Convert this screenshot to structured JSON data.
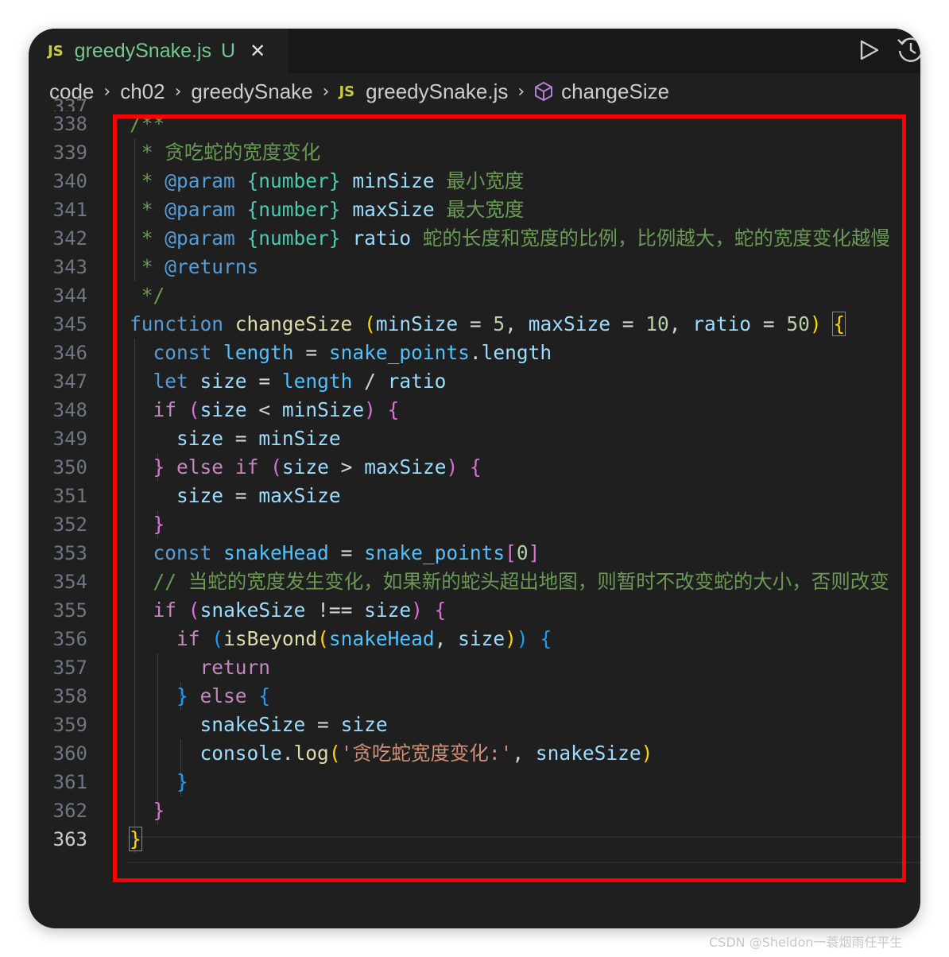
{
  "tab": {
    "icon": "JS",
    "filename": "greedySnake.js",
    "status": "U"
  },
  "breadcrumb": {
    "items": [
      "code",
      "ch02",
      "greedySnake",
      "greedySnake.js",
      "changeSize"
    ],
    "file_icon": "JS"
  },
  "code": {
    "partial_line_number": "337",
    "line_numbers": [
      "338",
      "339",
      "340",
      "341",
      "342",
      "343",
      "344",
      "345",
      "346",
      "347",
      "348",
      "349",
      "350",
      "351",
      "352",
      "353",
      "354",
      "355",
      "356",
      "357",
      "358",
      "359",
      "360",
      "361",
      "362",
      "363"
    ],
    "active_line": "363",
    "doc": {
      "open": "/**",
      "summary": " * 贪吃蛇的宽度变化",
      "star": " * ",
      "param_tag": "@param",
      "type_number": "{number}",
      "p1_name": "minSize",
      "p1_desc": "最小宽度",
      "p2_name": "maxSize",
      "p2_desc": "最大宽度",
      "p3_name": "ratio",
      "p3_desc": "蛇的长度和宽度的比例，比例越大，蛇的宽度变化越慢",
      "returns_tag": "@returns",
      "close": " */"
    },
    "identifiers": {
      "function_kw": "function",
      "changeSize": "changeSize",
      "minSize": "minSize",
      "maxSize": "maxSize",
      "ratio": "ratio",
      "const_kw": "const",
      "let_kw": "let",
      "if_kw": "if",
      "else_kw": "else",
      "return_kw": "return",
      "length": "length",
      "snake_points": "snake_points",
      "size": "size",
      "snakeHead": "snakeHead",
      "snakeSize": "snakeSize",
      "isBeyond": "isBeyond",
      "console": "console",
      "log": "log"
    },
    "literals": {
      "five": "5",
      "ten": "10",
      "fifty": "50",
      "zero": "0",
      "log_string": "'贪吃蛇宽度变化:'"
    },
    "line_comment": "// 当蛇的宽度发生变化，如果新的蛇头超出地图，则暂时不改变蛇的大小，否则改变"
  },
  "watermark": "CSDN @Sheldon一蓑烟雨任平生",
  "colors": {
    "background": "#1f1f1f",
    "comment": "#6a9955",
    "keyword": "#569cd6",
    "control": "#c586c0",
    "function": "#dcdcaa",
    "variable": "#9cdcfe",
    "constant": "#4fc1ff",
    "number": "#b5cea8",
    "string": "#ce9178",
    "highlight_border": "#ff0000"
  },
  "icons": {
    "tab_close": "close-icon",
    "run": "run-icon",
    "timeline": "timeline-icon",
    "breadcrumb_symbol": "cube-icon"
  }
}
